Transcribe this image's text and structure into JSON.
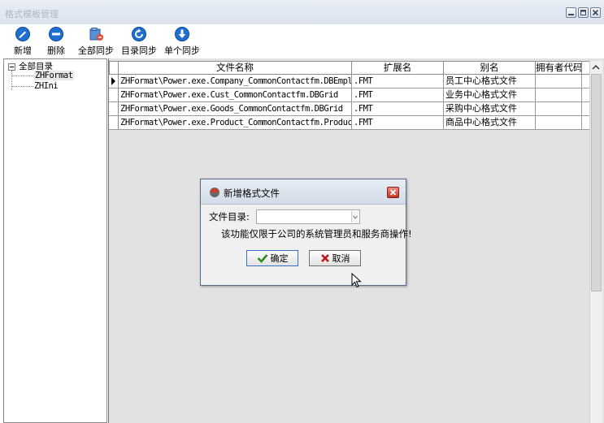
{
  "window": {
    "title": "格式模板管理"
  },
  "toolbar": {
    "new_label": "新增",
    "delete_label": "删除",
    "sync_all_label": "全部同步",
    "sync_dir_label": "目录同步",
    "sync_single_label": "单个同步"
  },
  "tree": {
    "root_label": "全部目录",
    "children": [
      "ZHFormat",
      "ZHIni"
    ]
  },
  "grid": {
    "columns": [
      "文件名称",
      "扩展名",
      "别名",
      "拥有者代码"
    ],
    "rows": [
      {
        "name": "ZHFormat\\Power.exe.Company_CommonContactfm.DBEmployeeG",
        "ext": ".FMT",
        "alias": "员工中心格式文件"
      },
      {
        "name": "ZHFormat\\Power.exe.Cust_CommonContactfm.DBGrid",
        "ext": ".FMT",
        "alias": "业务中心格式文件"
      },
      {
        "name": "ZHFormat\\Power.exe.Goods_CommonContactfm.DBGrid",
        "ext": ".FMT",
        "alias": "采购中心格式文件"
      },
      {
        "name": "ZHFormat\\Power.exe.Product_CommonContactfm.ProductDBGr",
        "ext": ".FMT",
        "alias": "商品中心格式文件"
      }
    ]
  },
  "dialog": {
    "title": "新增格式文件",
    "dir_label": "文件目录:",
    "dir_value": "",
    "notice": "该功能仅限于公司的系统管理员和服务商操作!",
    "ok_label": "确定",
    "cancel_label": "取消"
  },
  "colors": {
    "ok_check": "#2e8b1f",
    "cancel_x": "#c01818",
    "toolbar_icon": "#1f6fd0"
  }
}
